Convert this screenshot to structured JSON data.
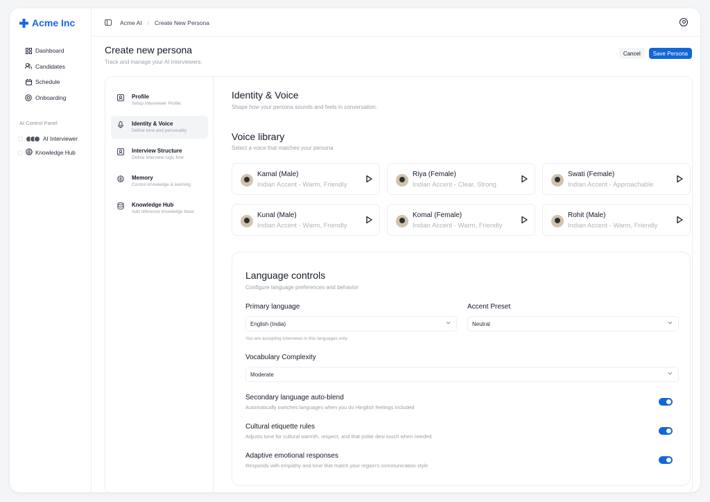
{
  "brand": {
    "name": "Acme Inc"
  },
  "sidebar": {
    "items": [
      {
        "label": "Dashboard",
        "icon": "grid-icon"
      },
      {
        "label": "Candidates",
        "icon": "users-icon"
      },
      {
        "label": "Schedule",
        "icon": "calendar-icon"
      },
      {
        "label": "Onboarding",
        "icon": "target-icon"
      }
    ],
    "section_label": "AI Control Panel",
    "sub_items": [
      {
        "label": "AI Interviewer",
        "icon": "avatars-group-icon"
      },
      {
        "label": "Knowledge Hub",
        "icon": "brain-icon"
      }
    ]
  },
  "topbar": {
    "breadcrumbs": [
      "Acme AI",
      "/",
      "Create New Persona"
    ]
  },
  "page": {
    "title": "Create new persona",
    "subtitle": "Track and manage your AI interviewers.",
    "cancel_label": "Cancel",
    "save_label": "Save Persona"
  },
  "steps": [
    {
      "title": "Profile",
      "desc": "Setup Interviewer Profile",
      "icon": "profile-icon"
    },
    {
      "title": "Identity & Voice",
      "desc": "Define tone and personality",
      "icon": "mic-icon"
    },
    {
      "title": "Interview Structure",
      "desc": "Define interview logic flow",
      "icon": "profile-icon"
    },
    {
      "title": "Memory",
      "desc": "Control knowledge & learning",
      "icon": "brain-icon"
    },
    {
      "title": "Knowledge Hub",
      "desc": "Add reference knowledge base",
      "icon": "database-icon"
    }
  ],
  "identity": {
    "title": "Identity & Voice",
    "subtitle": "Shape how your persona sounds and feels in conversation."
  },
  "voice_library": {
    "title": "Voice library",
    "subtitle": "Select a voice that matches your persona",
    "voices": [
      {
        "name": "Kamal (Male)",
        "desc": "Indian Accent - Warm, Friendly"
      },
      {
        "name": "Riya (Female)",
        "desc": "Indian Accent - Clear, Strong"
      },
      {
        "name": "Swati (Female)",
        "desc": "Indian Accent - Approachable"
      },
      {
        "name": "Kunal (Male)",
        "desc": "Indian Accent - Warm, Friendly"
      },
      {
        "name": "Komal (Female)",
        "desc": "Indian Accent - Warm, Friendly"
      },
      {
        "name": "Rohit (Male)",
        "desc": "Indian Accent - Warm, Friendly"
      }
    ]
  },
  "language": {
    "title": "Language controls",
    "subtitle": "Configure language preferences and behavior",
    "primary_label": "Primary language",
    "primary_value": "English (India)",
    "primary_hint": "You are accepting interviews in this languages only.",
    "accent_label": "Accent Preset",
    "accent_value": "Neutral",
    "vocab_label": "Vocabulary Complexity",
    "vocab_value": "Moderate",
    "toggles": [
      {
        "title": "Secondary language auto-blend",
        "desc": "Automatically switches languages when you do Hinglish feelings included",
        "on": true
      },
      {
        "title": "Cultural etiquette rules",
        "desc": "Adjusts tone for cultural warmth, respect, and that polite desi touch when needed",
        "on": true
      },
      {
        "title": "Adaptive emotional responses",
        "desc": "Responds with empathy and tone that match your region's communication style",
        "on": true
      }
    ]
  },
  "colors": {
    "accent": "#1366d6",
    "brand": "#1768e0"
  }
}
